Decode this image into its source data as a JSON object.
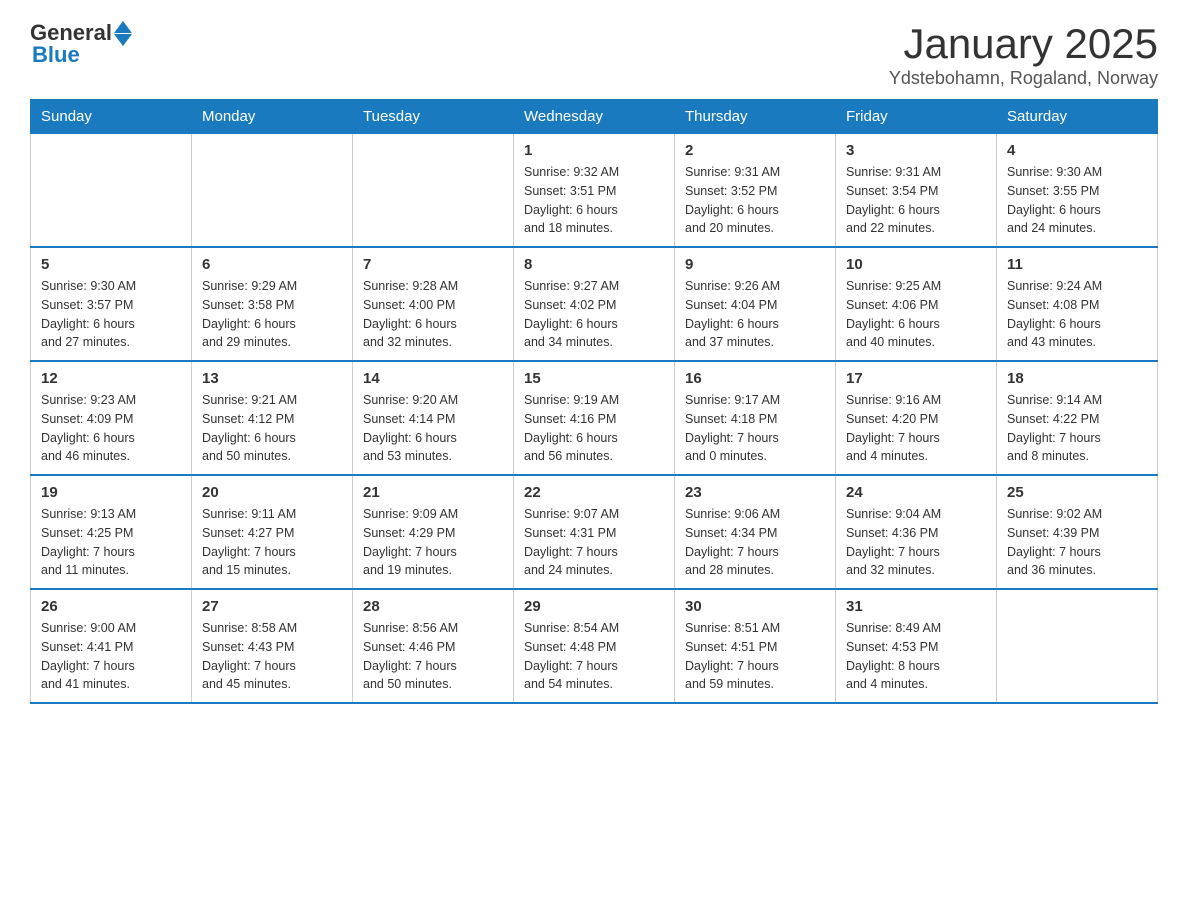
{
  "logo": {
    "general": "General",
    "blue": "Blue"
  },
  "title": "January 2025",
  "location": "Ydstebohamn, Rogaland, Norway",
  "days_of_week": [
    "Sunday",
    "Monday",
    "Tuesday",
    "Wednesday",
    "Thursday",
    "Friday",
    "Saturday"
  ],
  "weeks": [
    [
      {
        "day": "",
        "info": ""
      },
      {
        "day": "",
        "info": ""
      },
      {
        "day": "",
        "info": ""
      },
      {
        "day": "1",
        "info": "Sunrise: 9:32 AM\nSunset: 3:51 PM\nDaylight: 6 hours\nand 18 minutes."
      },
      {
        "day": "2",
        "info": "Sunrise: 9:31 AM\nSunset: 3:52 PM\nDaylight: 6 hours\nand 20 minutes."
      },
      {
        "day": "3",
        "info": "Sunrise: 9:31 AM\nSunset: 3:54 PM\nDaylight: 6 hours\nand 22 minutes."
      },
      {
        "day": "4",
        "info": "Sunrise: 9:30 AM\nSunset: 3:55 PM\nDaylight: 6 hours\nand 24 minutes."
      }
    ],
    [
      {
        "day": "5",
        "info": "Sunrise: 9:30 AM\nSunset: 3:57 PM\nDaylight: 6 hours\nand 27 minutes."
      },
      {
        "day": "6",
        "info": "Sunrise: 9:29 AM\nSunset: 3:58 PM\nDaylight: 6 hours\nand 29 minutes."
      },
      {
        "day": "7",
        "info": "Sunrise: 9:28 AM\nSunset: 4:00 PM\nDaylight: 6 hours\nand 32 minutes."
      },
      {
        "day": "8",
        "info": "Sunrise: 9:27 AM\nSunset: 4:02 PM\nDaylight: 6 hours\nand 34 minutes."
      },
      {
        "day": "9",
        "info": "Sunrise: 9:26 AM\nSunset: 4:04 PM\nDaylight: 6 hours\nand 37 minutes."
      },
      {
        "day": "10",
        "info": "Sunrise: 9:25 AM\nSunset: 4:06 PM\nDaylight: 6 hours\nand 40 minutes."
      },
      {
        "day": "11",
        "info": "Sunrise: 9:24 AM\nSunset: 4:08 PM\nDaylight: 6 hours\nand 43 minutes."
      }
    ],
    [
      {
        "day": "12",
        "info": "Sunrise: 9:23 AM\nSunset: 4:09 PM\nDaylight: 6 hours\nand 46 minutes."
      },
      {
        "day": "13",
        "info": "Sunrise: 9:21 AM\nSunset: 4:12 PM\nDaylight: 6 hours\nand 50 minutes."
      },
      {
        "day": "14",
        "info": "Sunrise: 9:20 AM\nSunset: 4:14 PM\nDaylight: 6 hours\nand 53 minutes."
      },
      {
        "day": "15",
        "info": "Sunrise: 9:19 AM\nSunset: 4:16 PM\nDaylight: 6 hours\nand 56 minutes."
      },
      {
        "day": "16",
        "info": "Sunrise: 9:17 AM\nSunset: 4:18 PM\nDaylight: 7 hours\nand 0 minutes."
      },
      {
        "day": "17",
        "info": "Sunrise: 9:16 AM\nSunset: 4:20 PM\nDaylight: 7 hours\nand 4 minutes."
      },
      {
        "day": "18",
        "info": "Sunrise: 9:14 AM\nSunset: 4:22 PM\nDaylight: 7 hours\nand 8 minutes."
      }
    ],
    [
      {
        "day": "19",
        "info": "Sunrise: 9:13 AM\nSunset: 4:25 PM\nDaylight: 7 hours\nand 11 minutes."
      },
      {
        "day": "20",
        "info": "Sunrise: 9:11 AM\nSunset: 4:27 PM\nDaylight: 7 hours\nand 15 minutes."
      },
      {
        "day": "21",
        "info": "Sunrise: 9:09 AM\nSunset: 4:29 PM\nDaylight: 7 hours\nand 19 minutes."
      },
      {
        "day": "22",
        "info": "Sunrise: 9:07 AM\nSunset: 4:31 PM\nDaylight: 7 hours\nand 24 minutes."
      },
      {
        "day": "23",
        "info": "Sunrise: 9:06 AM\nSunset: 4:34 PM\nDaylight: 7 hours\nand 28 minutes."
      },
      {
        "day": "24",
        "info": "Sunrise: 9:04 AM\nSunset: 4:36 PM\nDaylight: 7 hours\nand 32 minutes."
      },
      {
        "day": "25",
        "info": "Sunrise: 9:02 AM\nSunset: 4:39 PM\nDaylight: 7 hours\nand 36 minutes."
      }
    ],
    [
      {
        "day": "26",
        "info": "Sunrise: 9:00 AM\nSunset: 4:41 PM\nDaylight: 7 hours\nand 41 minutes."
      },
      {
        "day": "27",
        "info": "Sunrise: 8:58 AM\nSunset: 4:43 PM\nDaylight: 7 hours\nand 45 minutes."
      },
      {
        "day": "28",
        "info": "Sunrise: 8:56 AM\nSunset: 4:46 PM\nDaylight: 7 hours\nand 50 minutes."
      },
      {
        "day": "29",
        "info": "Sunrise: 8:54 AM\nSunset: 4:48 PM\nDaylight: 7 hours\nand 54 minutes."
      },
      {
        "day": "30",
        "info": "Sunrise: 8:51 AM\nSunset: 4:51 PM\nDaylight: 7 hours\nand 59 minutes."
      },
      {
        "day": "31",
        "info": "Sunrise: 8:49 AM\nSunset: 4:53 PM\nDaylight: 8 hours\nand 4 minutes."
      },
      {
        "day": "",
        "info": ""
      }
    ]
  ]
}
